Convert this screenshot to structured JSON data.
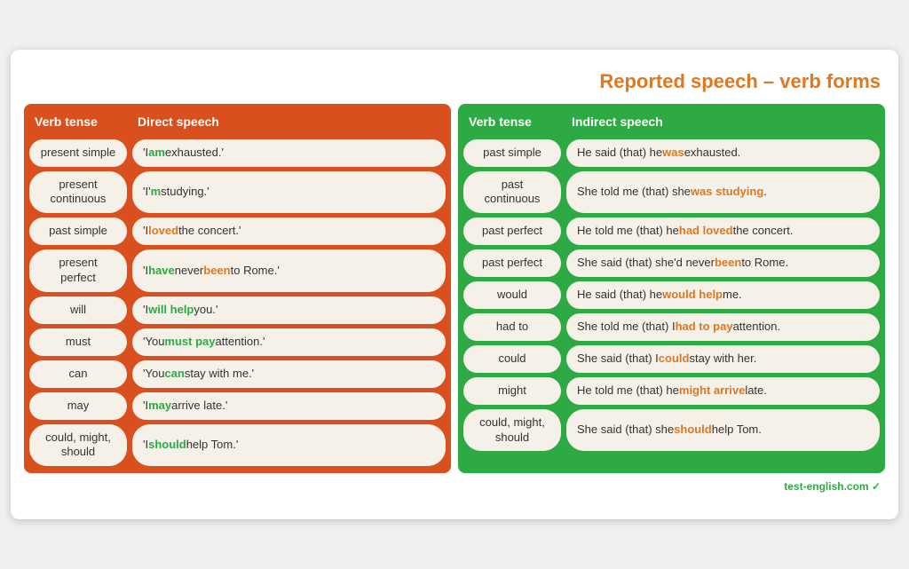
{
  "page": {
    "title": "Reported speech – verb forms",
    "footer": "test-english.com"
  },
  "direct_table": {
    "headers": {
      "verb_tense": "Verb tense",
      "speech": "Direct speech"
    },
    "rows": [
      {
        "verb_tense": "present simple",
        "speech_html": "'I <span class=\"hl-green\">am</span> exhausted.'"
      },
      {
        "verb_tense": "present continuous",
        "speech_html": "'I'<span class=\"hl-green\">m</span> studying.'"
      },
      {
        "verb_tense": "past simple",
        "speech_html": "'I <span class=\"hl-orange\">loved</span> the concert.'"
      },
      {
        "verb_tense": "present perfect",
        "speech_html": "'I <span class=\"hl-green\">have</span> never <span class=\"hl-orange\">been</span> to Rome.'"
      },
      {
        "verb_tense": "will",
        "speech_html": "'I <span class=\"hl-green\">will help</span> you.'"
      },
      {
        "verb_tense": "must",
        "speech_html": "'You <span class=\"hl-green\">must pay</span> attention.'"
      },
      {
        "verb_tense": "can",
        "speech_html": "'You <span class=\"hl-green\">can</span> stay with me.'"
      },
      {
        "verb_tense": "may",
        "speech_html": "'I <span class=\"hl-green\">may</span> arrive late.'"
      },
      {
        "verb_tense": "could, might, should",
        "speech_html": "'I <span class=\"hl-green\">should</span> help Tom.'"
      }
    ]
  },
  "indirect_table": {
    "headers": {
      "verb_tense": "Verb tense",
      "speech": "Indirect speech"
    },
    "rows": [
      {
        "verb_tense": "past simple",
        "speech_html": "He said (that) he <span class=\"hl-orange\">was</span> exhausted."
      },
      {
        "verb_tense": "past continuous",
        "speech_html": "She told me (that) she <span class=\"hl-orange\">was studying</span>."
      },
      {
        "verb_tense": "past perfect",
        "speech_html": "He told me (that) he <span class=\"hl-orange\">had loved</span> the concert."
      },
      {
        "verb_tense": "past perfect",
        "speech_html": "She said (that) she'd never <span class=\"hl-orange\">been</span> to Rome."
      },
      {
        "verb_tense": "would",
        "speech_html": "He said (that) he <span class=\"hl-orange\">would help</span> me."
      },
      {
        "verb_tense": "had to",
        "speech_html": "She told me (that) I <span class=\"hl-orange\">had to pay</span> attention."
      },
      {
        "verb_tense": "could",
        "speech_html": "She said (that) I <span class=\"hl-orange\">could</span> stay with her."
      },
      {
        "verb_tense": "might",
        "speech_html": "He told me (that) he <span class=\"hl-orange\">might arrive</span> late."
      },
      {
        "verb_tense": "could, might, should",
        "speech_html": "She said (that) she <span class=\"hl-orange\">should</span> help Tom."
      }
    ]
  }
}
